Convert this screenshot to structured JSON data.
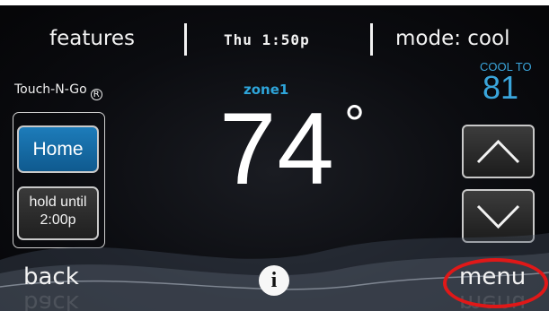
{
  "topbar": {
    "features_label": "features",
    "time_display": "Thu 1:50p",
    "mode_label": "mode: cool"
  },
  "brand": {
    "name": "Touch-N-Go",
    "registered_mark": "R"
  },
  "zone": {
    "name": "zone1",
    "current_temp": "74",
    "degree_symbol": "°"
  },
  "setpoint": {
    "label": "COOL TO",
    "value": "81"
  },
  "side": {
    "home_label": "Home",
    "hold_line1": "hold until",
    "hold_line2": "2:00p"
  },
  "bottom": {
    "back_label": "back",
    "info_label": "i",
    "menu_label": "menu"
  },
  "colors": {
    "accent_blue": "#2ea5da",
    "home_button": "#1d7cba",
    "highlight_circle": "#e01818",
    "background": "#0b0c10"
  },
  "icons": {
    "up": "chevron-up-icon",
    "down": "chevron-down-icon",
    "info": "info-icon"
  }
}
